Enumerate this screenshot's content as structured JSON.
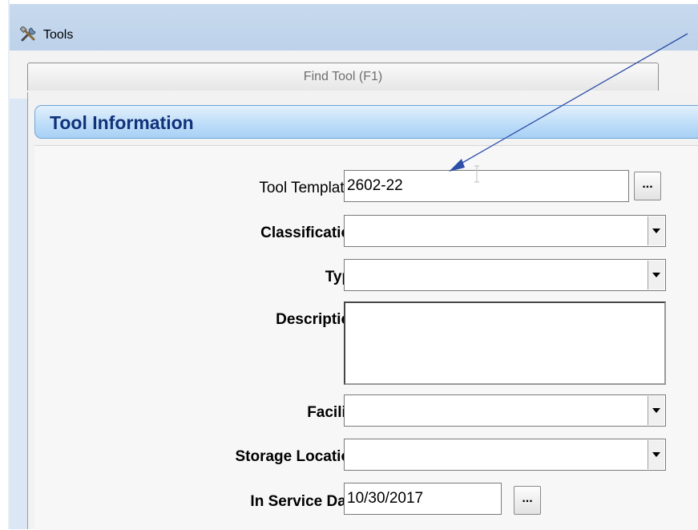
{
  "window": {
    "title": "Tools"
  },
  "tabs": [
    {
      "label": "Find Tool (F1)"
    }
  ],
  "section": {
    "title": "Tool Information"
  },
  "form": {
    "tool_templates": {
      "label": "Tool Templates:",
      "value": "2602-22",
      "button": "..."
    },
    "classification": {
      "label": "Classification:",
      "value": ""
    },
    "type": {
      "label": "Type:",
      "value": ""
    },
    "description": {
      "label": "Description:",
      "value": ""
    },
    "facility": {
      "label": "Facility:",
      "value": ""
    },
    "storage_location": {
      "label": "Storage Location:",
      "value": ""
    },
    "in_service_date": {
      "label": "In Service Date:",
      "value": "10/30/2017",
      "button": "..."
    }
  },
  "colors": {
    "section_title": "#10327a",
    "annotation_arrow": "#2e4fa8"
  },
  "icons": {
    "window": "tools-icon",
    "dropdown": "chevron-down-icon"
  }
}
